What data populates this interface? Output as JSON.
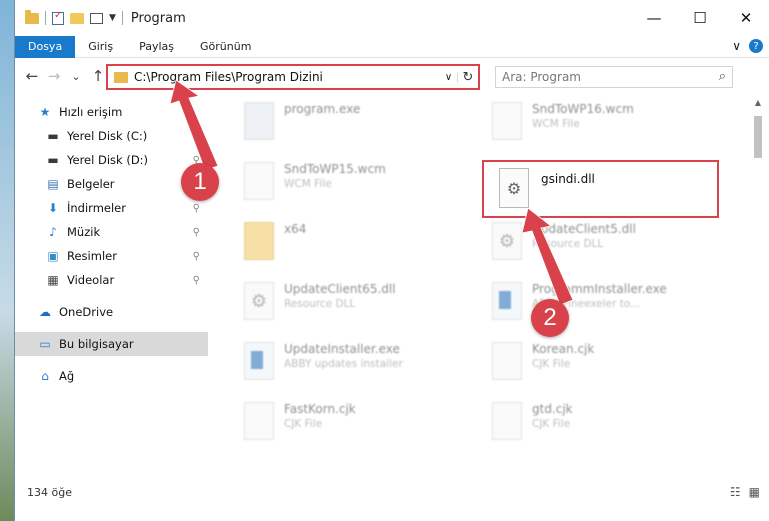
{
  "window": {
    "title": "Program",
    "controls": {
      "minimize": "—",
      "maximize": "☐",
      "close": "✕"
    }
  },
  "ribbon": {
    "tabs": [
      "Dosya",
      "Giriş",
      "Paylaş",
      "Görünüm"
    ],
    "active_tab": "Dosya",
    "expand_icon": "∨",
    "help_icon": "?"
  },
  "nav": {
    "back": "←",
    "forward": "→",
    "recent": "⌄",
    "up": "↑"
  },
  "address": {
    "path": "C:\\Program Files\\Program Dizini",
    "dropdown": "∨",
    "refresh": "↻"
  },
  "search": {
    "placeholder": "Ara: Program",
    "icon": "⌕"
  },
  "sidebar": {
    "items": [
      {
        "label": "Hızlı erişim",
        "icon": "star-icon",
        "glyph": "★",
        "color": "#2b7cd3",
        "pinned": false
      },
      {
        "label": "Yerel Disk (C:)",
        "icon": "drive-icon",
        "glyph": "▬",
        "color": "#3a3a3a",
        "pinned": true
      },
      {
        "label": "Yerel Disk (D:)",
        "icon": "drive-icon",
        "glyph": "▬",
        "color": "#3a3a3a",
        "pinned": true
      },
      {
        "label": "Belgeler",
        "icon": "documents-icon",
        "glyph": "▤",
        "color": "#3c6fb0",
        "pinned": true
      },
      {
        "label": "İndirmeler",
        "icon": "download-icon",
        "glyph": "⬇",
        "color": "#2b7cd3",
        "pinned": true
      },
      {
        "label": "Müzik",
        "icon": "music-icon",
        "glyph": "♪",
        "color": "#2b7cd3",
        "pinned": true
      },
      {
        "label": "Resimler",
        "icon": "pictures-icon",
        "glyph": "▣",
        "color": "#3a8ac4",
        "pinned": true
      },
      {
        "label": "Videolar",
        "icon": "videos-icon",
        "glyph": "▦",
        "color": "#444",
        "pinned": true
      },
      {
        "label": "OneDrive",
        "icon": "cloud-icon",
        "glyph": "☁",
        "color": "#1c6fcf",
        "pinned": false
      },
      {
        "label": "Bu bilgisayar",
        "icon": "computer-icon",
        "glyph": "▭",
        "color": "#2b7cd3",
        "pinned": false
      },
      {
        "label": "Ağ",
        "icon": "network-icon",
        "glyph": "⌂",
        "color": "#2b7cd3",
        "pinned": false
      }
    ],
    "pin_glyph": "📌"
  },
  "files": {
    "col1": [
      {
        "name": "program.exe",
        "type": ""
      },
      {
        "name": "SndToWP15.wcm",
        "type": "WCM File"
      },
      {
        "name": "x64",
        "type": ""
      },
      {
        "name": "UpdateClient65.dll",
        "type": "Resource DLL"
      },
      {
        "name": "UpdateInstaller.exe",
        "type": "ABBY updates installer"
      },
      {
        "name": "FastKorn.cjk",
        "type": "CJK File"
      }
    ],
    "col2": [
      {
        "name": "SndToWP16.wcm",
        "type": "WCM File"
      },
      {
        "name": "gsindi.dll",
        "type": ""
      },
      {
        "name": "UpdateClient5.dll",
        "type": "Resource DLL"
      },
      {
        "name": "ProgrammInstaller.exe",
        "type": "ABBY Fineexeler to..."
      },
      {
        "name": "Korean.cjk",
        "type": "CJK File"
      },
      {
        "name": "gtd.cjk",
        "type": "CJK File"
      }
    ],
    "highlighted": "gsindi.dll"
  },
  "status": {
    "count": "134 öğe",
    "views": {
      "details": "☷",
      "tiles": "▦"
    }
  },
  "annotations": {
    "badge1": "1",
    "badge2": "2",
    "accent": "#d9414b"
  }
}
